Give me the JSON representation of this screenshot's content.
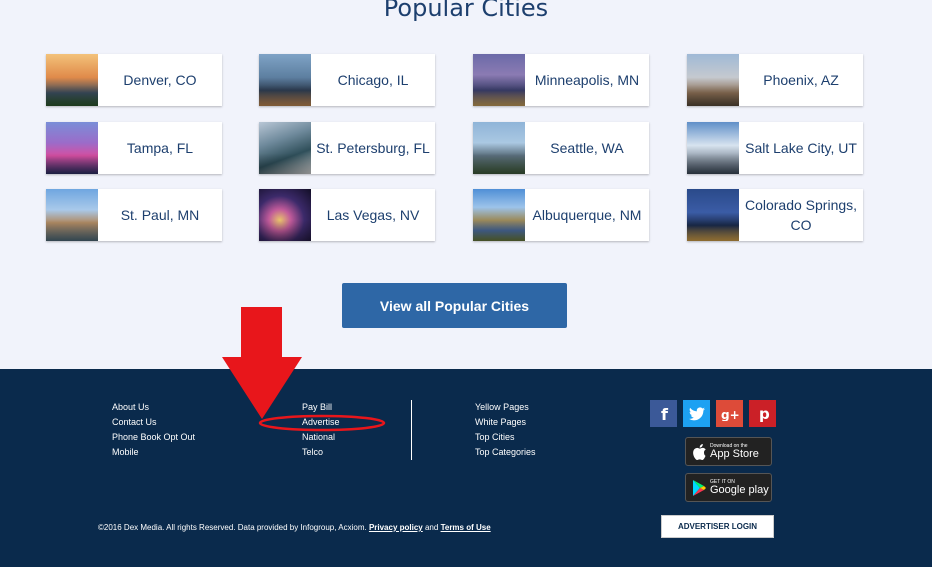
{
  "page": {
    "title": "Popular Cities"
  },
  "cities": [
    {
      "label": "Denver, CO",
      "thumb_icon": "denver-photo"
    },
    {
      "label": "Chicago, IL",
      "thumb_icon": "chicago-photo"
    },
    {
      "label": "Minneapolis, MN",
      "thumb_icon": "minneapolis-photo"
    },
    {
      "label": "Phoenix, AZ",
      "thumb_icon": "phoenix-photo"
    },
    {
      "label": "Tampa, FL",
      "thumb_icon": "tampa-photo"
    },
    {
      "label": "St. Petersburg, FL",
      "thumb_icon": "st-petersburg-photo"
    },
    {
      "label": "Seattle, WA",
      "thumb_icon": "seattle-photo"
    },
    {
      "label": "Salt Lake City, UT",
      "thumb_icon": "salt-lake-city-photo"
    },
    {
      "label": "St. Paul, MN",
      "thumb_icon": "st-paul-photo"
    },
    {
      "label": "Las Vegas, NV",
      "thumb_icon": "las-vegas-photo"
    },
    {
      "label": "Albuquerque, NM",
      "thumb_icon": "albuquerque-photo"
    },
    {
      "label": "Colorado Springs, CO",
      "thumb_icon": "colorado-springs-photo"
    }
  ],
  "view_all_label": "View all Popular Cities",
  "footer": {
    "col1": [
      "About Us",
      "Contact Us",
      "Phone Book Opt Out",
      "Mobile"
    ],
    "col2": [
      "Pay Bill",
      "Advertise",
      "National",
      "Telco"
    ],
    "col3": [
      "Yellow Pages",
      "White Pages",
      "Top Cities",
      "Top Categories"
    ],
    "social": [
      {
        "name": "facebook-icon",
        "glyph": "f",
        "color": "#3b5998"
      },
      {
        "name": "twitter-icon",
        "glyph": "t",
        "color": "#1da1f2"
      },
      {
        "name": "google-plus-icon",
        "glyph": "g+",
        "color": "#dd4b39"
      },
      {
        "name": "pinterest-icon",
        "glyph": "p",
        "color": "#cb2027"
      }
    ],
    "app_store": {
      "small": "Download on the",
      "big": "App Store"
    },
    "google_play": {
      "small": "GET IT ON",
      "big": "Google play"
    },
    "copyright_text": "©2016 Dex Media. All rights Reserved. Data provided by Infogroup, Acxiom.",
    "privacy_label": "Privacy policy",
    "and_text": "and",
    "terms_label": "Terms of Use",
    "advertiser_login": "ADVERTISER LOGIN"
  },
  "colors": {
    "page_bg": "#f1f3fb",
    "title_text": "#1d3f6e",
    "button_bg": "#2e67a6",
    "footer_bg": "#0a2a4c",
    "annotation_red": "#e8161b"
  }
}
